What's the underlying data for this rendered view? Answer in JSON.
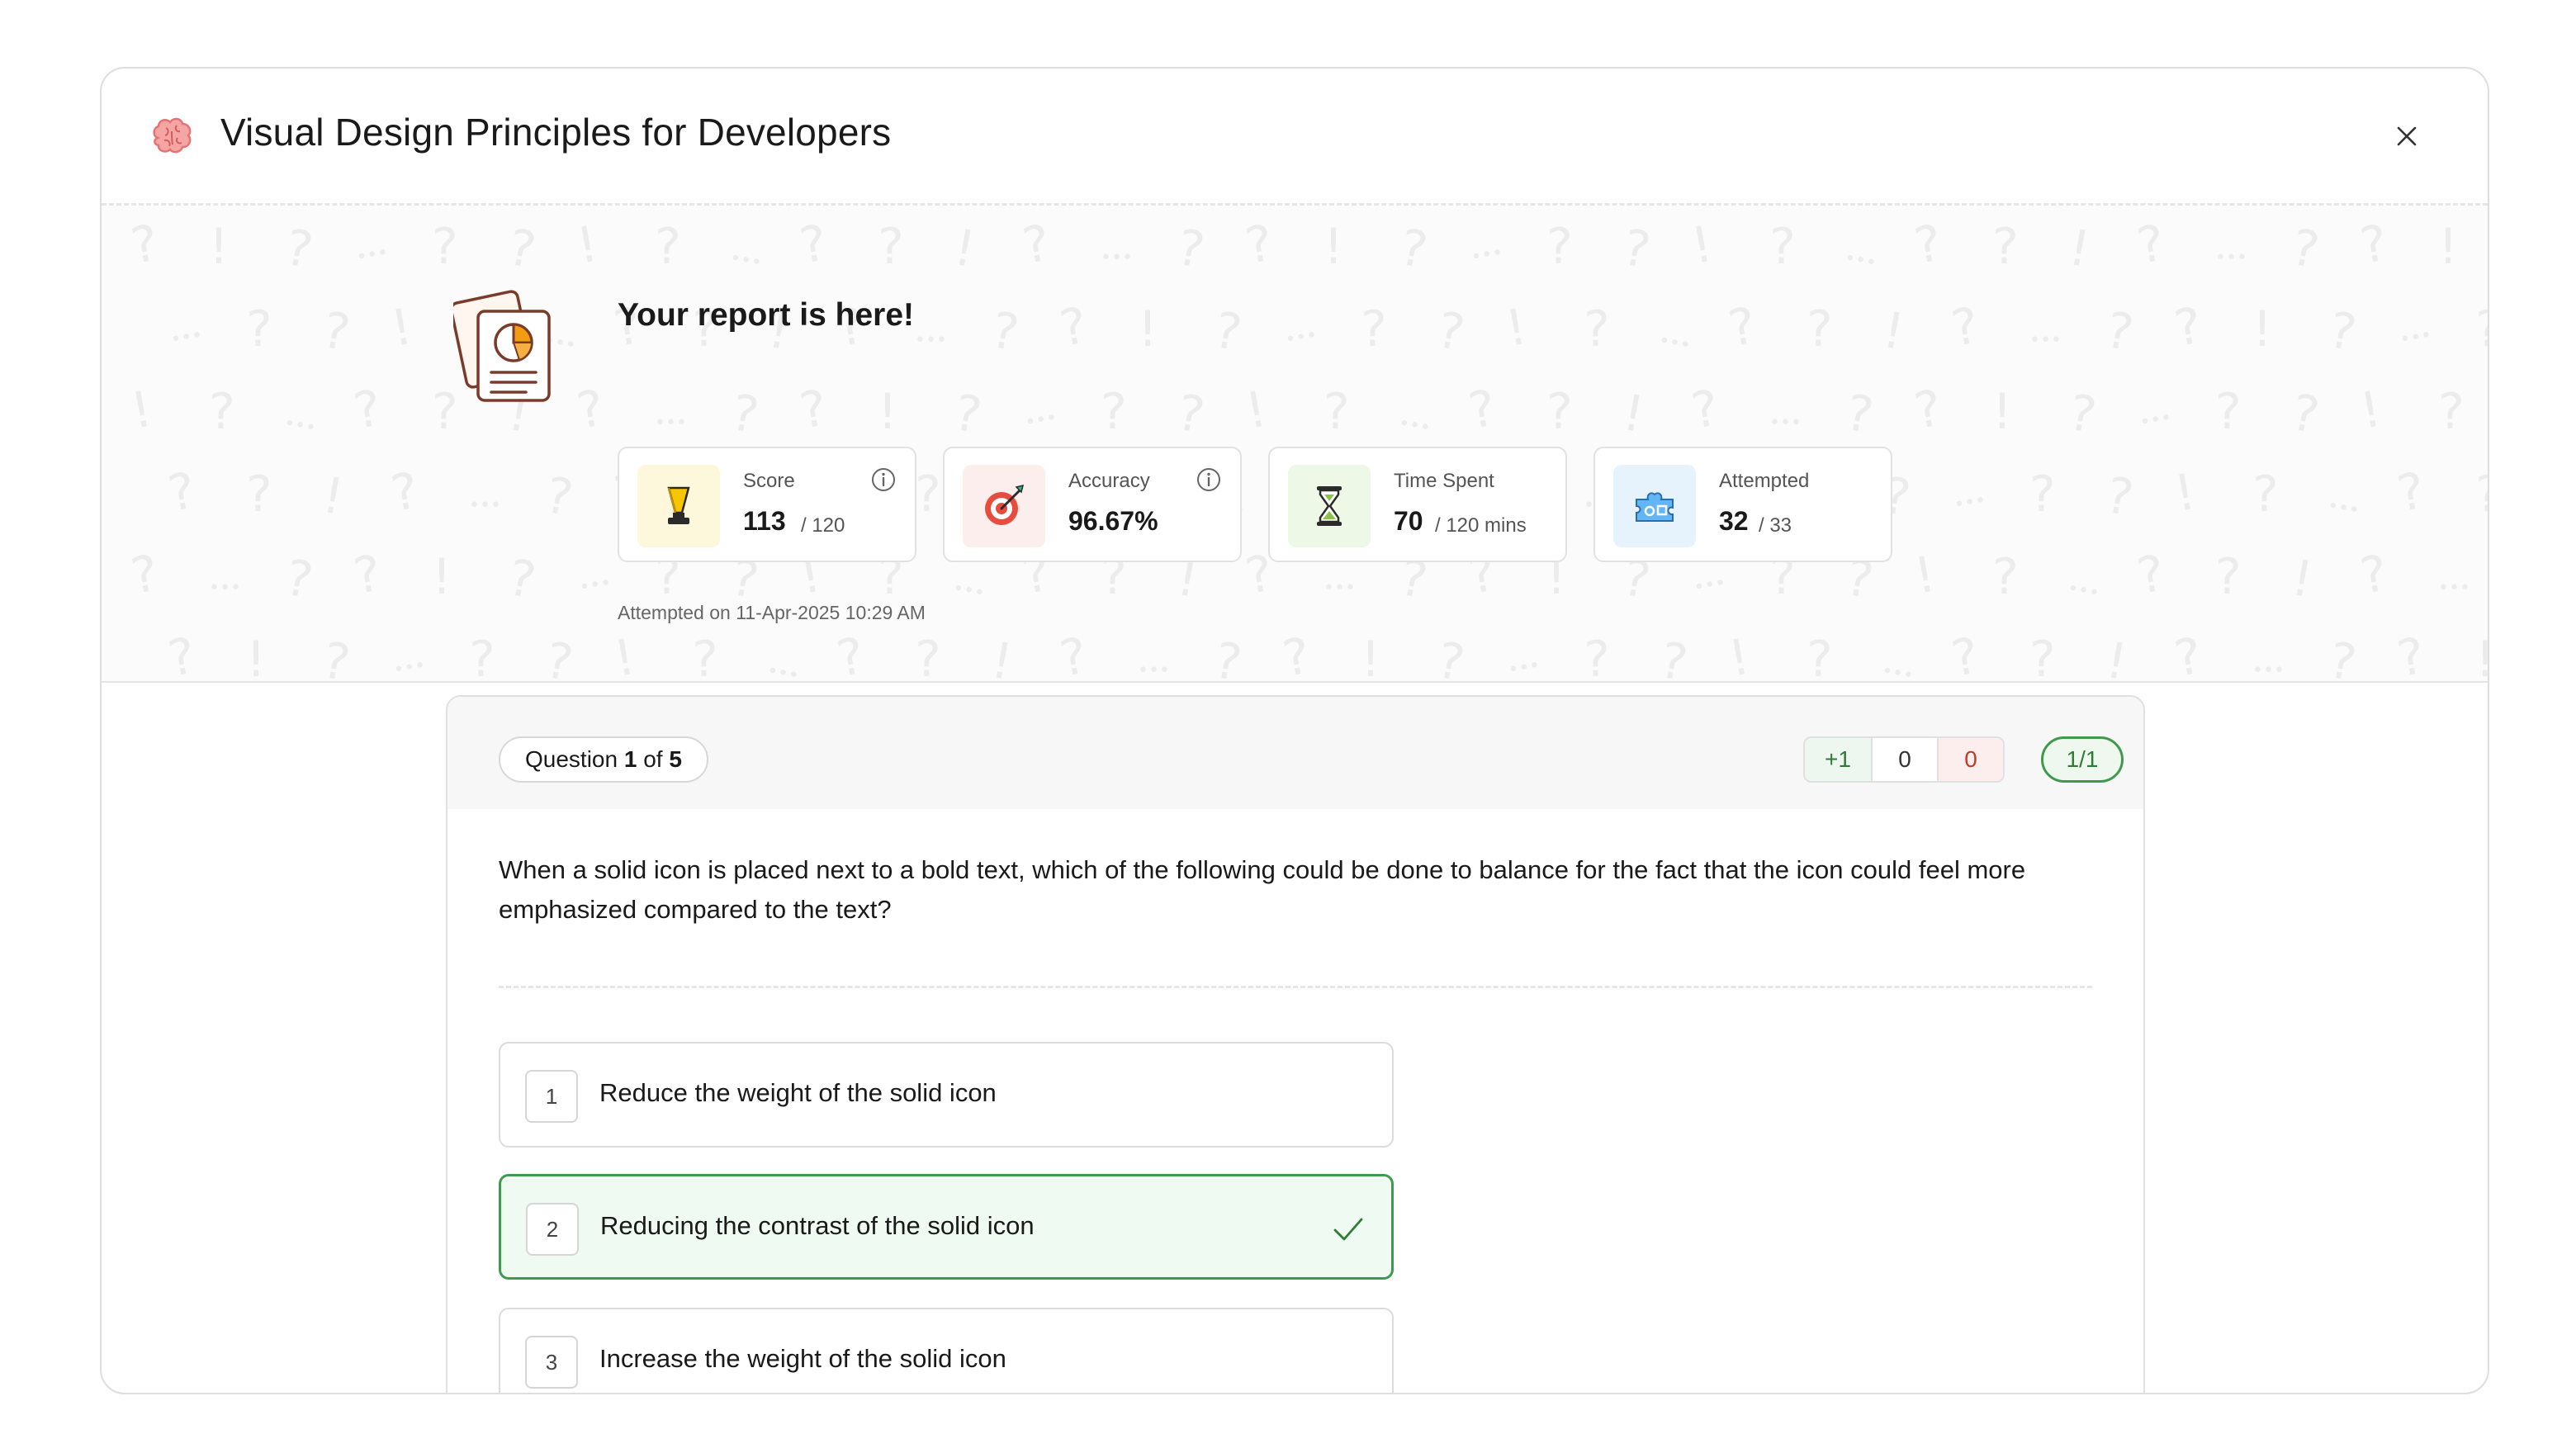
{
  "modal": {
    "title": "Visual Design Principles for Developers"
  },
  "report": {
    "heading": "Your report is here!",
    "attempted_on": "Attempted on 11-Apr-2025 10:29 AM",
    "stats": [
      {
        "label": "Score",
        "value": "113",
        "sub": "/ 120",
        "icon": "trophy-icon",
        "accent": "#fdf8dc"
      },
      {
        "label": "Accuracy",
        "value": "96.67%",
        "sub": "",
        "icon": "target-icon",
        "accent": "#fdeeee"
      },
      {
        "label": "Time Spent",
        "value": "70",
        "sub": "/ 120 mins",
        "icon": "hourglass-icon",
        "accent": "#eef8e6"
      },
      {
        "label": "Attempted",
        "value": "32",
        "sub": "/ 33",
        "icon": "puzzle-icon",
        "accent": "#e6f3fd"
      }
    ]
  },
  "question": {
    "pill_prefix": "Question ",
    "pill_current": "1",
    "pill_mid": " of ",
    "pill_total": "5",
    "marks": {
      "positive": "+1",
      "neutral": "0",
      "negative": "0"
    },
    "result": "1/1",
    "text": "When a solid icon is placed next to a bold text, which of the following could be done to balance for the fact that the icon could feel more emphasized compared to the text?",
    "options": [
      {
        "number": "1",
        "label": "Reduce the weight of the solid icon",
        "correct": false
      },
      {
        "number": "2",
        "label": "Reducing the contrast of the solid icon",
        "correct": true
      },
      {
        "number": "3",
        "label": "Increase the weight of the solid icon",
        "correct": false
      }
    ]
  },
  "colors": {
    "correct_border": "#3f9a4e",
    "correct_background": "#effaf2",
    "accent_red": "#c0392b"
  }
}
